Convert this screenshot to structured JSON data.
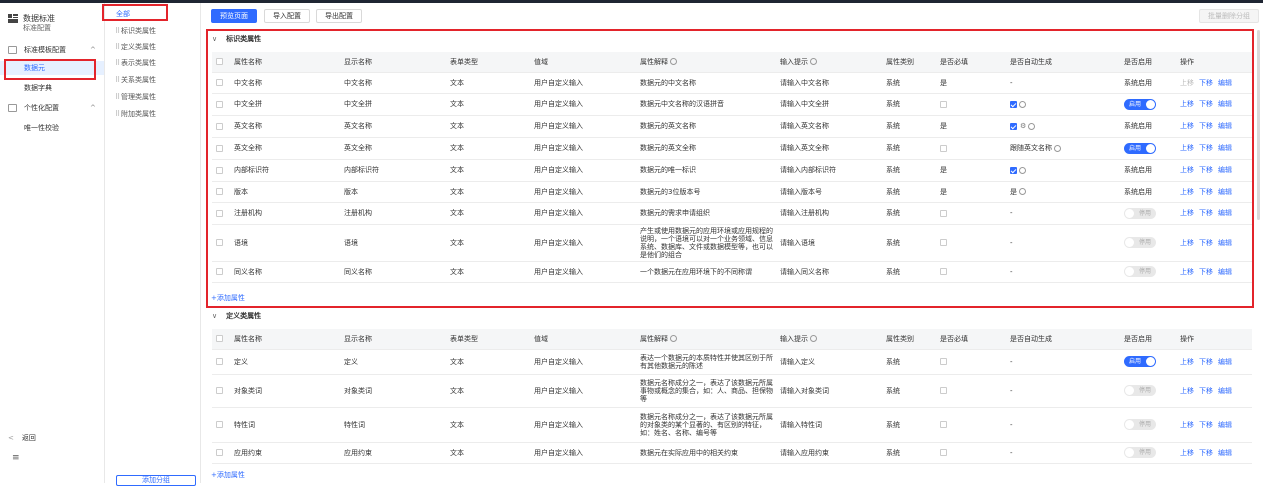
{
  "nav": {
    "title": "数据标准",
    "subtitle": "标准配置",
    "items": [
      {
        "label": "标准模板配置",
        "arrow": "^"
      },
      {
        "label": "数据元"
      },
      {
        "label": "数据字典"
      },
      {
        "label": "个性化配置",
        "arrow": "^"
      },
      {
        "label": "唯一性校验"
      }
    ],
    "back": "返回",
    "menu_icon": "≡"
  },
  "groups": {
    "items": [
      "全部",
      "标识类属性",
      "定义类属性",
      "表示类属性",
      "关系类属性",
      "管理类属性",
      "附加类属性"
    ],
    "add_label": "添加分组"
  },
  "toolbar": {
    "preview": "预览页面",
    "import": "导入配置",
    "export": "导出配置",
    "batch": "批量删除分组"
  },
  "columns": [
    "属性名称",
    "显示名称",
    "表单类型",
    "值域",
    "属性解释",
    "输入提示",
    "属性类别",
    "是否必填",
    "是否自动生成",
    "是否启用",
    "操作"
  ],
  "actions": {
    "up": "上移",
    "down": "下移",
    "edit": "编辑"
  },
  "switch_on": "启用",
  "switch_off": "停用",
  "add_attr": "+添加属性",
  "sections": [
    {
      "title": "标识类属性",
      "rows": [
        {
          "name": "中文名称",
          "display": "中文名称",
          "form": "文本",
          "domain": "用户自定义输入",
          "explain": "数据元的中文名称",
          "hint": "请输入中文名称",
          "cat": "系统",
          "required": "是",
          "auto": "-",
          "auto_type": "text",
          "enable": "系统启用",
          "enable_type": "text",
          "up_disabled": true
        },
        {
          "name": "中文全拼",
          "display": "中文全拼",
          "form": "文本",
          "domain": "用户自定义输入",
          "explain": "数据元中文名称的汉语拼音",
          "hint": "请输入中文全拼",
          "cat": "系统",
          "required": "",
          "auto": "",
          "auto_type": "check",
          "enable": "启用",
          "enable_type": "on"
        },
        {
          "name": "英文名称",
          "display": "英文名称",
          "form": "文本",
          "domain": "用户自定义输入",
          "explain": "数据元的英文名称",
          "hint": "请输入英文名称",
          "cat": "系统",
          "required": "是",
          "auto": "",
          "auto_type": "checkgear",
          "enable": "系统启用",
          "enable_type": "text"
        },
        {
          "name": "英文全称",
          "display": "英文全称",
          "form": "文本",
          "domain": "用户自定义输入",
          "explain": "数据元的英文全称",
          "hint": "请输入英文全称",
          "cat": "系统",
          "required": "",
          "auto": "跟随英文名称",
          "auto_type": "textq",
          "enable": "启用",
          "enable_type": "on"
        },
        {
          "name": "内部标识符",
          "display": "内部标识符",
          "form": "文本",
          "domain": "用户自定义输入",
          "explain": "数据元的唯一标识",
          "hint": "请输入内部标识符",
          "cat": "系统",
          "required": "是",
          "auto": "",
          "auto_type": "check",
          "enable": "系统启用",
          "enable_type": "text"
        },
        {
          "name": "版本",
          "display": "版本",
          "form": "文本",
          "domain": "用户自定义输入",
          "explain": "数据元的3位版本号",
          "hint": "请输入版本号",
          "cat": "系统",
          "required": "是",
          "auto": "是",
          "auto_type": "textq",
          "enable": "系统启用",
          "enable_type": "text"
        },
        {
          "name": "注册机构",
          "display": "注册机构",
          "form": "文本",
          "domain": "用户自定义输入",
          "explain": "数据元的需求申请组织",
          "hint": "请输入注册机构",
          "cat": "系统",
          "required": "",
          "auto": "-",
          "auto_type": "text",
          "enable": "停用",
          "enable_type": "off"
        },
        {
          "name": "语境",
          "display": "语境",
          "form": "文本",
          "domain": "用户自定义输入",
          "explain": "产生或使用数据元的应用环境或应用规程的说明，一个语境可以对一个业务领域、信息系统、数据库、文件或数据模型等，也可以是他们的组合",
          "hint": "请输入语境",
          "cat": "系统",
          "required": "",
          "auto": "-",
          "auto_type": "text",
          "enable": "停用",
          "enable_type": "off"
        },
        {
          "name": "同义名称",
          "display": "同义名称",
          "form": "文本",
          "domain": "用户自定义输入",
          "explain": "一个数据元在应用环境下的不同称谓",
          "hint": "请输入同义名称",
          "cat": "系统",
          "required": "",
          "auto": "-",
          "auto_type": "text",
          "enable": "停用",
          "enable_type": "off"
        }
      ]
    },
    {
      "title": "定义类属性",
      "rows": [
        {
          "name": "定义",
          "display": "定义",
          "form": "文本",
          "domain": "用户自定义输入",
          "explain": "表达一个数据元的本质特性并使其区别于所有其他数据元的陈述",
          "hint": "请输入定义",
          "cat": "系统",
          "required": "",
          "auto": "-",
          "auto_type": "text",
          "enable": "启用",
          "enable_type": "on"
        },
        {
          "name": "对象类词",
          "display": "对象类词",
          "form": "文本",
          "domain": "用户自定义输入",
          "explain": "数据元名称成分之一，表达了该数据元所属事物或概念的集合，如：人、商品、担保物等",
          "hint": "请输入对象类词",
          "cat": "系统",
          "required": "",
          "auto": "-",
          "auto_type": "text",
          "enable": "停用",
          "enable_type": "off"
        },
        {
          "name": "特性词",
          "display": "特性词",
          "form": "文本",
          "domain": "用户自定义输入",
          "explain": "数据元名称成分之一，表达了该数据元所属的对象类的某个显著的、有区别的特征，如：姓名、名称、编号等",
          "hint": "请输入特性词",
          "cat": "系统",
          "required": "",
          "auto": "-",
          "auto_type": "text",
          "enable": "停用",
          "enable_type": "off"
        },
        {
          "name": "应用约束",
          "display": "应用约束",
          "form": "文本",
          "domain": "用户自定义输入",
          "explain": "数据元在实际应用中的相关约束",
          "hint": "请输入应用约束",
          "cat": "系统",
          "required": "",
          "auto": "-",
          "auto_type": "text",
          "enable": "停用",
          "enable_type": "off"
        }
      ]
    }
  ]
}
